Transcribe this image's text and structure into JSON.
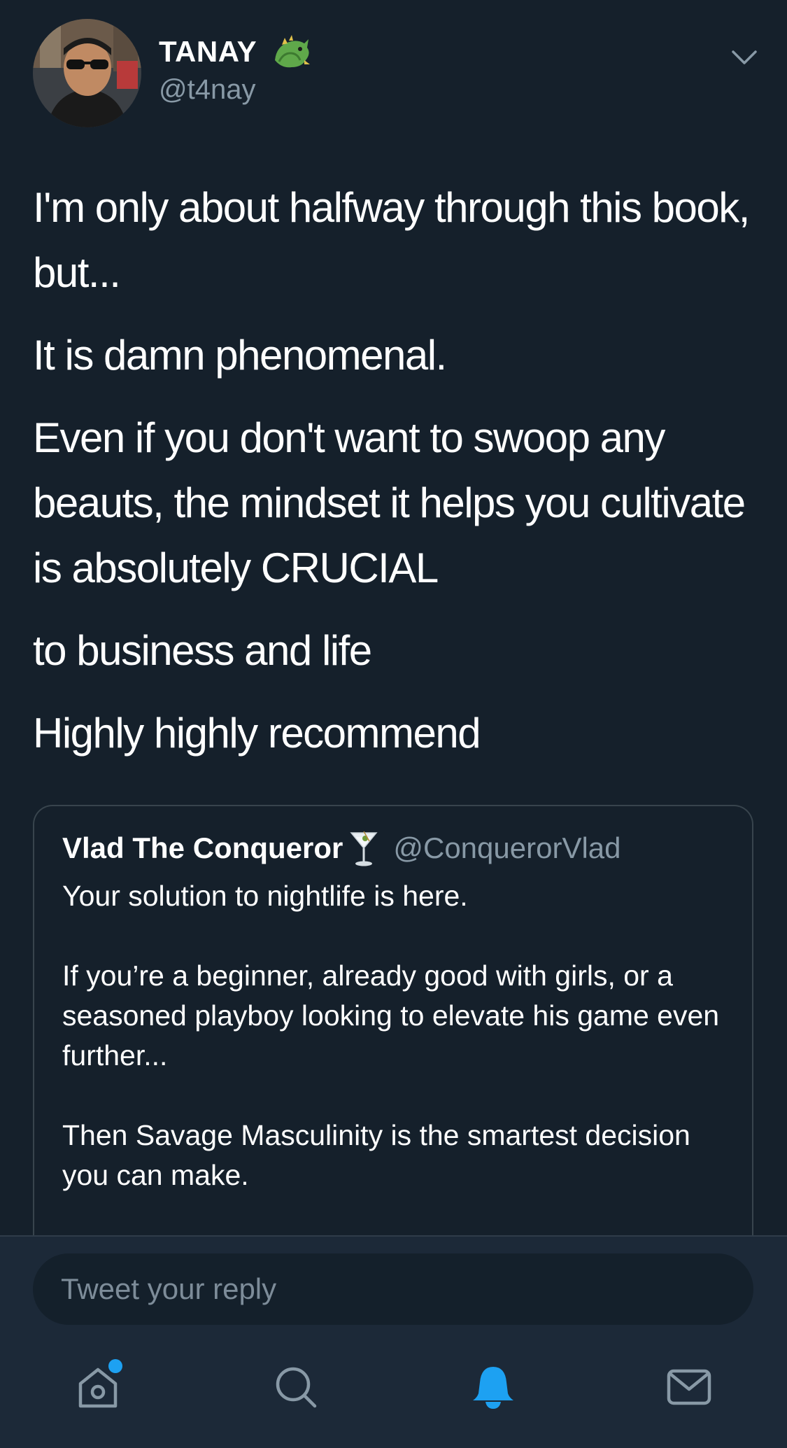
{
  "header": {
    "display_name": "TANAY",
    "handle": "@t4nay",
    "name_emoji": "dragon-emoji"
  },
  "tweet": {
    "paragraphs": [
      "I'm only about halfway through this book, but...",
      "It is damn phenomenal.",
      "Even if you don't want to swoop any beauts, the mindset it helps you cultivate is absolutely CRUCIAL",
      "to business and life",
      "Highly highly recommend"
    ]
  },
  "quoted_tweet": {
    "display_name": "Vlad The Conqueror",
    "name_emoji": "martini-emoji",
    "handle": "@ConquerorVlad",
    "paragraphs": [
      "Your solution to nightlife is here.",
      "If you’re a beginner, already good with girls, or a seasoned playboy looking to elevate his game even further...",
      "Then Savage Masculinity is the smartest decision you can make."
    ]
  },
  "reply": {
    "placeholder": "Tweet your reply"
  },
  "nav": {
    "items": [
      "home-icon",
      "search-icon",
      "notifications-icon",
      "messages-icon"
    ],
    "active": "notifications-icon",
    "home_has_dot": true
  },
  "colors": {
    "background": "#15202b",
    "bottom_bar": "#1c2938",
    "secondary_text": "#8899a6",
    "accent": "#1da1f2",
    "border": "#38444d"
  }
}
